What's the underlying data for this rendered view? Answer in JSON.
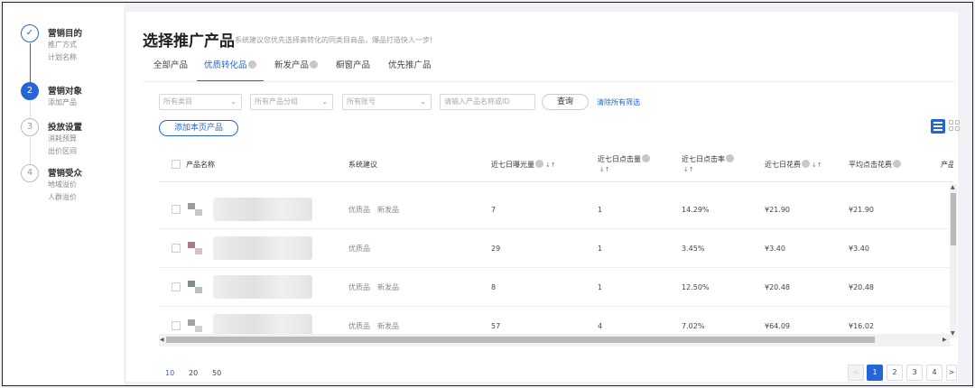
{
  "steps": [
    {
      "title": "营销目的",
      "subs": [
        "推广方式",
        "计划名称"
      ],
      "state": "done",
      "num": "✓"
    },
    {
      "title": "营销对象",
      "subs": [
        "添加产品"
      ],
      "state": "active",
      "num": "2"
    },
    {
      "title": "投放设置",
      "subs": [
        "消耗预算",
        "出价区间"
      ],
      "state": "todo",
      "num": "3"
    },
    {
      "title": "营销受众",
      "subs": [
        "地域溢价",
        "人群溢价"
      ],
      "state": "todo",
      "num": "4"
    }
  ],
  "header": {
    "title": "选择推广产品",
    "hint": "系统建议您优先选择高转化的同类目商品，爆品打造快人一步!"
  },
  "tabs": [
    {
      "label": "全部产品"
    },
    {
      "label": "优质转化品"
    },
    {
      "label": "新发产品"
    },
    {
      "label": "橱窗产品"
    },
    {
      "label": "优先推广品"
    }
  ],
  "filters": {
    "category": "所有类目",
    "group": "所有产品分组",
    "account": "所有账号",
    "search_placeholder": "请输入产品名称或ID",
    "query_label": "查询",
    "clear_label": "清除所有筛选",
    "add_label": "添加本页产品"
  },
  "table": {
    "headers": {
      "name": "产品名称",
      "suggest": "系统建议",
      "exposure": "近七日曝光量",
      "clicks": "近七日点击量",
      "ctr": "近七日点击率",
      "spend": "近七日花费",
      "avg_cpc": "平均点击花费",
      "more": "产品"
    },
    "rows": [
      {
        "tags": [
          "优质品",
          "新发品"
        ],
        "exposure": "7",
        "clicks": "1",
        "ctr": "14.29%",
        "spend": "¥21.90",
        "avg_cpc": "¥21.90",
        "thumb": [
          "#9c9c9c",
          "#c8c8c8"
        ]
      },
      {
        "tags": [
          "优质品"
        ],
        "exposure": "29",
        "clicks": "1",
        "ctr": "3.45%",
        "spend": "¥3.40",
        "avg_cpc": "¥3.40",
        "thumb": [
          "#a97b86",
          "#d7c0c6"
        ]
      },
      {
        "tags": [
          "优质品",
          "新发品"
        ],
        "exposure": "8",
        "clicks": "1",
        "ctr": "12.50%",
        "spend": "¥20.48",
        "avg_cpc": "¥20.48",
        "thumb": [
          "#7e8e8a",
          "#b7c2bf"
        ]
      },
      {
        "tags": [
          "优质品",
          "新发品"
        ],
        "exposure": "57",
        "clicks": "4",
        "ctr": "7.02%",
        "spend": "¥64.09",
        "avg_cpc": "¥16.02",
        "thumb": [
          "#a3a3a3",
          "#d0d0d0"
        ]
      }
    ]
  },
  "pagination": {
    "sizes": [
      "10",
      "20",
      "50"
    ],
    "pages": [
      "1",
      "2",
      "3",
      "4"
    ],
    "prev": "<",
    "next": ">"
  },
  "colors": {
    "accent": "#2466d8"
  }
}
